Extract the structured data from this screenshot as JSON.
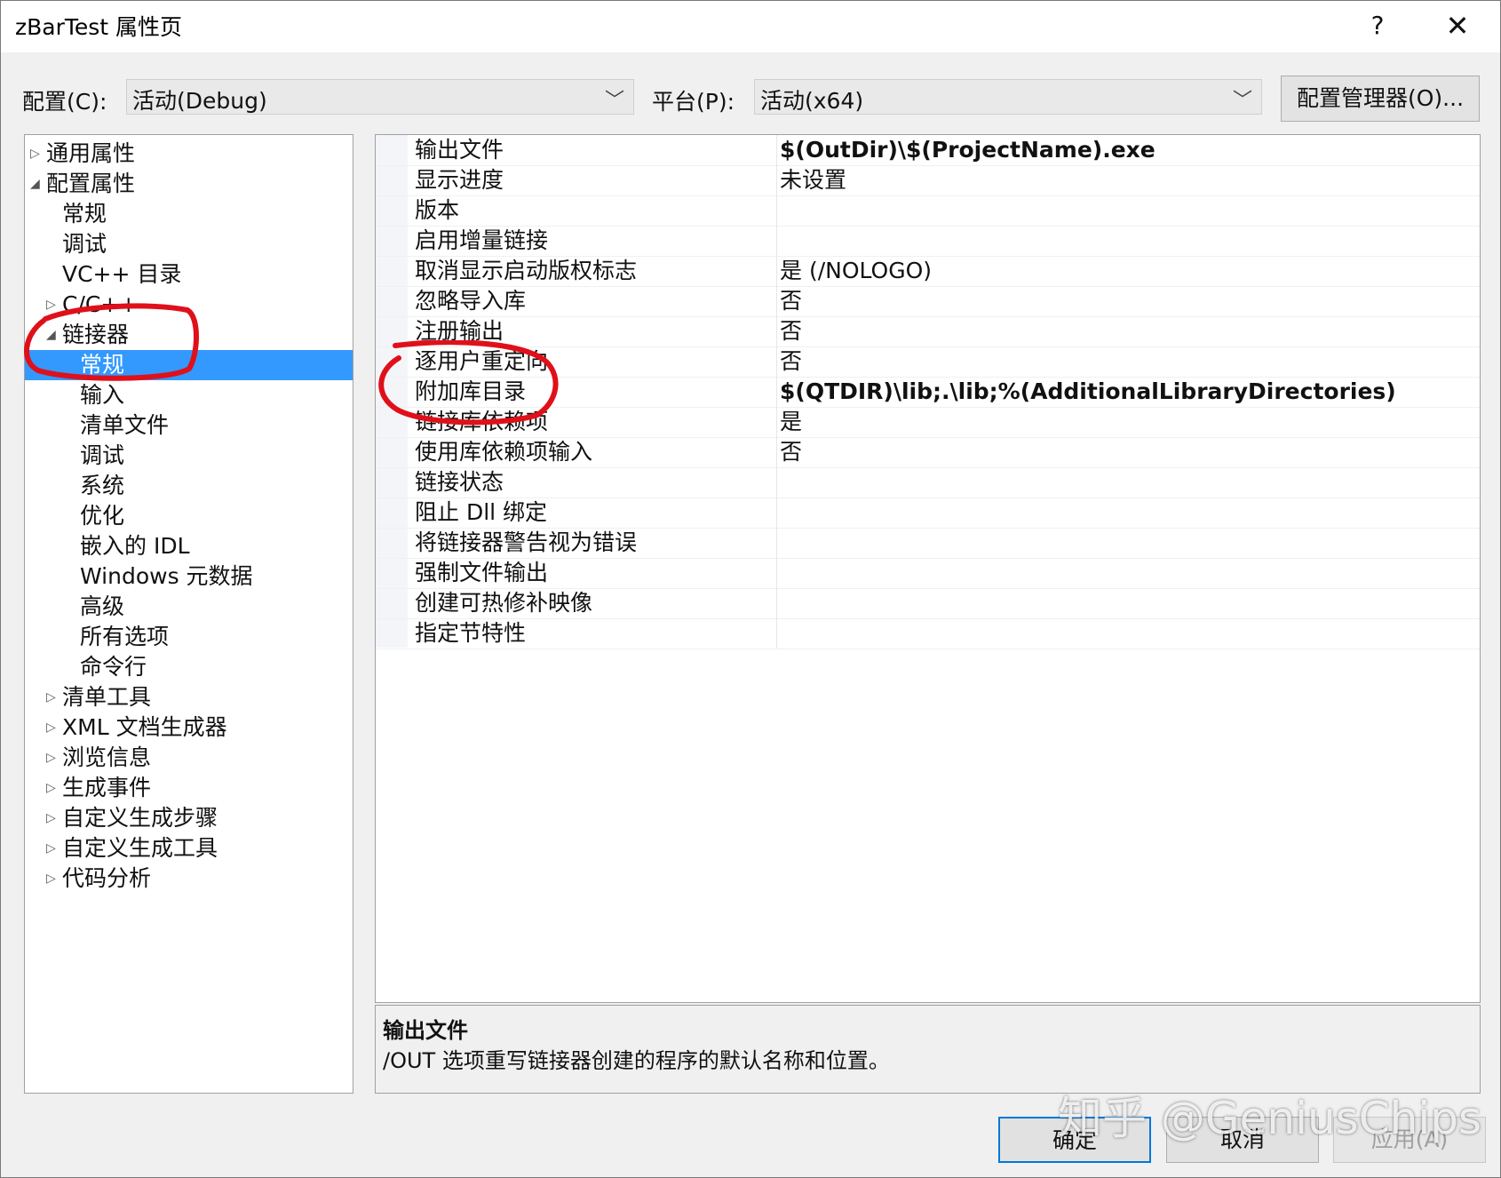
{
  "window": {
    "title": "zBarTest 属性页",
    "help_glyph": "?",
    "close_glyph": "✕"
  },
  "config_bar": {
    "config_label": "配置(C):",
    "config_value": "活动(Debug)",
    "platform_label": "平台(P):",
    "platform_value": "活动(x64)",
    "manager_button": "配置管理器(O)...",
    "dropdown_glyph": "﹀"
  },
  "tree": {
    "items": [
      {
        "label": "通用属性",
        "expander": "▷"
      },
      {
        "label": "配置属性",
        "expander": "◢"
      },
      {
        "label": "常规",
        "expander": ""
      },
      {
        "label": "调试",
        "expander": ""
      },
      {
        "label": "VC++ 目录",
        "expander": ""
      },
      {
        "label": "C/C++",
        "expander": "▷"
      },
      {
        "label": "链接器",
        "expander": "◢"
      },
      {
        "label": "常规",
        "expander": ""
      },
      {
        "label": "输入",
        "expander": ""
      },
      {
        "label": "清单文件",
        "expander": ""
      },
      {
        "label": "调试",
        "expander": ""
      },
      {
        "label": "系统",
        "expander": ""
      },
      {
        "label": "优化",
        "expander": ""
      },
      {
        "label": "嵌入的 IDL",
        "expander": ""
      },
      {
        "label": "Windows 元数据",
        "expander": ""
      },
      {
        "label": "高级",
        "expander": ""
      },
      {
        "label": "所有选项",
        "expander": ""
      },
      {
        "label": "命令行",
        "expander": ""
      },
      {
        "label": "清单工具",
        "expander": "▷"
      },
      {
        "label": "XML 文档生成器",
        "expander": "▷"
      },
      {
        "label": "浏览信息",
        "expander": "▷"
      },
      {
        "label": "生成事件",
        "expander": "▷"
      },
      {
        "label": "自定义生成步骤",
        "expander": "▷"
      },
      {
        "label": "自定义生成工具",
        "expander": "▷"
      },
      {
        "label": "代码分析",
        "expander": "▷"
      }
    ],
    "selected_index": 7
  },
  "properties": [
    {
      "name": "输出文件",
      "value": "$(OutDir)\\$(ProjectName).exe",
      "bold": true
    },
    {
      "name": "显示进度",
      "value": "未设置",
      "bold": false
    },
    {
      "name": "版本",
      "value": "",
      "bold": false
    },
    {
      "name": "启用增量链接",
      "value": "",
      "bold": false
    },
    {
      "name": "取消显示启动版权标志",
      "value": "是 (/NOLOGO)",
      "bold": false
    },
    {
      "name": "忽略导入库",
      "value": "否",
      "bold": false
    },
    {
      "name": "注册输出",
      "value": "否",
      "bold": false
    },
    {
      "name": "逐用户重定向",
      "value": "否",
      "bold": false
    },
    {
      "name": "附加库目录",
      "value": "$(QTDIR)\\lib;.\\lib;%(AdditionalLibraryDirectories)",
      "bold": true
    },
    {
      "name": "链接库依赖项",
      "value": "是",
      "bold": false
    },
    {
      "name": "使用库依赖项输入",
      "value": "否",
      "bold": false
    },
    {
      "name": "链接状态",
      "value": "",
      "bold": false
    },
    {
      "name": "阻止 Dll 绑定",
      "value": "",
      "bold": false
    },
    {
      "name": "将链接器警告视为错误",
      "value": "",
      "bold": false
    },
    {
      "name": "强制文件输出",
      "value": "",
      "bold": false
    },
    {
      "name": "创建可热修补映像",
      "value": "",
      "bold": false
    },
    {
      "name": "指定节特性",
      "value": "",
      "bold": false
    }
  ],
  "description": {
    "title": "输出文件",
    "text": "/OUT 选项重写链接器创建的程序的默认名称和位置。"
  },
  "buttons": {
    "ok": "确定",
    "cancel": "取消",
    "apply": "应用(A)"
  },
  "watermark": "知乎 @GeniusChips",
  "colors": {
    "selection": "#3399ff",
    "annotation": "#e0101a",
    "default_button_border": "#0078d7"
  }
}
